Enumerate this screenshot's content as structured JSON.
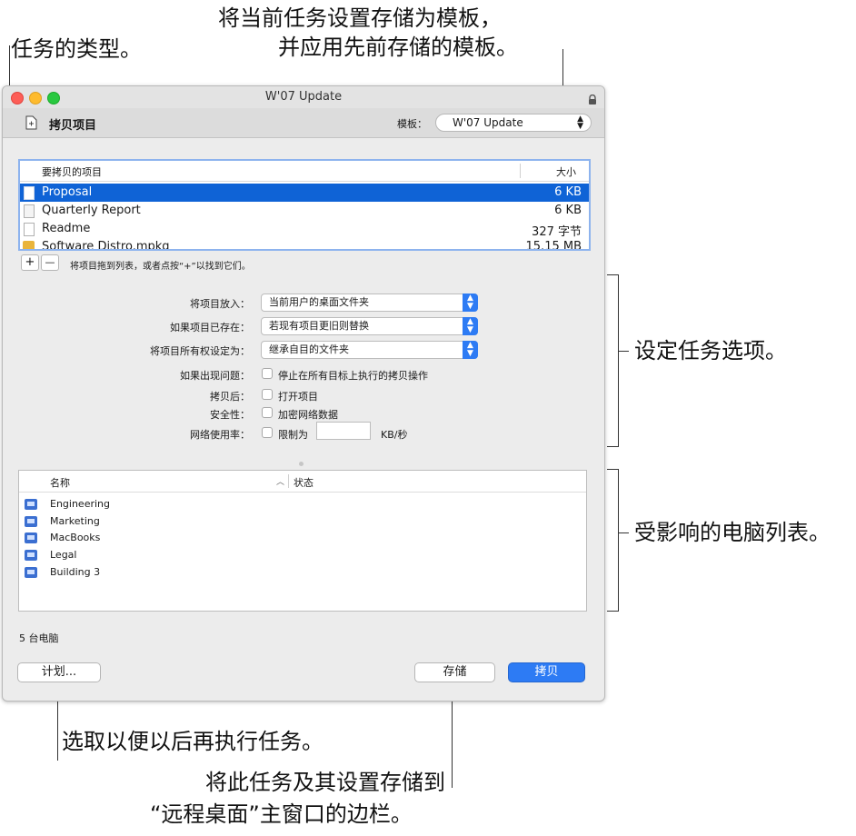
{
  "callouts": {
    "task_type": "任务的类型。",
    "template_line1": "将当前任务设置存储为模板，",
    "template_line2": "并应用先前存储的模板。",
    "options": "设定任务选项。",
    "computer_list": "受影响的电脑列表。",
    "schedule": "选取以便以后再执行任务。",
    "save_line1": "将此任务及其设置存储到",
    "save_line2": "“远程桌面”主窗口的边栏。"
  },
  "window": {
    "title": "W'07 Update",
    "task_name": "拷贝项目",
    "template_label": "模板：",
    "template_value": "W'07 Update"
  },
  "items_table": {
    "col_name": "要拷贝的项目",
    "col_size": "大小",
    "rows": [
      {
        "name": "Proposal",
        "size": "6 KB",
        "selected": true
      },
      {
        "name": "Quarterly Report",
        "size": "6 KB"
      },
      {
        "name": "Readme",
        "size": "327 字节"
      },
      {
        "name": "Software Distro.mpkg",
        "size": "15.15 MB"
      }
    ],
    "add_label": "+",
    "remove_label": "—",
    "hint": "将项目拖到列表，或者点按“+”以找到它们。"
  },
  "options": {
    "place_label": "将项目放入：",
    "place_value": "当前用户的桌面文件夹",
    "exists_label": "如果项目已存在：",
    "exists_value": "若现有项目更旧则替换",
    "owner_label": "将项目所有权设定为：",
    "owner_value": "继承自目的文件夹",
    "problem_label": "如果出现问题：",
    "problem_value": "停止在所有目标上执行的拷贝操作",
    "after_label": "拷贝后：",
    "after_value": "打开项目",
    "security_label": "安全性：",
    "security_value": "加密网络数据",
    "network_label": "网络使用率：",
    "network_value": "限制为",
    "network_unit": "KB/秒"
  },
  "computers_table": {
    "col_name": "名称",
    "col_status": "状态",
    "rows": [
      "Engineering",
      "Marketing",
      "MacBooks",
      "Legal",
      "Building 3"
    ],
    "count": "5 台电脑"
  },
  "buttons": {
    "schedule": "计划...",
    "save": "存储",
    "copy": "拷贝"
  },
  "colors": {
    "accent": "#2d7bf4",
    "selection": "#0f63d6"
  }
}
